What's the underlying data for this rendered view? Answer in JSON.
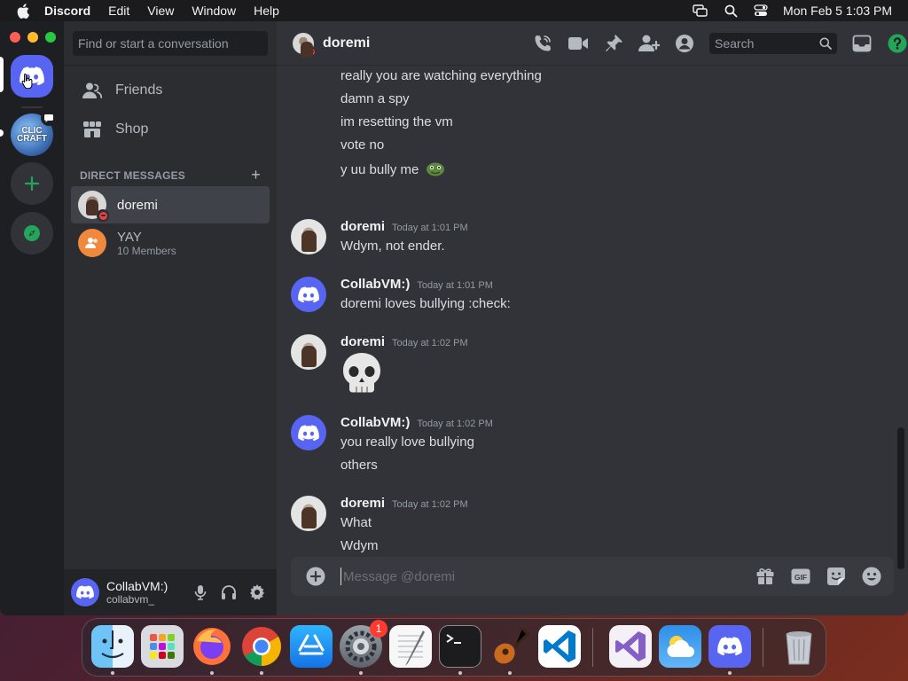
{
  "menubar": {
    "app_name": "Discord",
    "menus": [
      "Edit",
      "View",
      "Window",
      "Help"
    ],
    "clock": "Mon Feb 5  1:03 PM"
  },
  "sidebar": {
    "search_placeholder": "Find or start a conversation",
    "nav": [
      {
        "label": "Friends",
        "icon": "friends-icon"
      },
      {
        "label": "Shop",
        "icon": "shop-icon"
      }
    ],
    "dm_header": "DIRECT MESSAGES",
    "dms": [
      {
        "name": "doremi",
        "subtitle": "",
        "status": "dnd",
        "active": true
      },
      {
        "name": "YAY",
        "subtitle": "10 Members",
        "status": "",
        "active": false
      }
    ]
  },
  "server_rail": {
    "server_art_text": "CLIC CRAFT"
  },
  "user_panel": {
    "display_name": "CollabVM:)",
    "username": "collabvm_"
  },
  "chat": {
    "title": "doremi",
    "search_placeholder": "Search",
    "continued_lines": [
      "really you are watching everything",
      "damn a spy",
      "im resetting the vm",
      "vote no",
      "y uu bully me"
    ],
    "messages": [
      {
        "author": "doremi",
        "time": "Today at 1:01 PM",
        "lines": [
          "Wdym, not ender."
        ]
      },
      {
        "author": "CollabVM:)",
        "time": "Today at 1:01 PM",
        "lines": [
          "doremi loves bullying :check:"
        ]
      },
      {
        "author": "doremi",
        "time": "Today at 1:02 PM",
        "lines": []
      },
      {
        "author": "CollabVM:)",
        "time": "Today at 1:02 PM",
        "lines": [
          "you really love bullying",
          "others"
        ]
      },
      {
        "author": "doremi",
        "time": "Today at 1:02 PM",
        "lines": [
          "What",
          "Wdym"
        ]
      }
    ],
    "composer_placeholder": "Message @doremi"
  },
  "dock": {
    "apps": [
      "Finder",
      "Launchpad",
      "Firefox",
      "Chrome",
      "App Store",
      "System Settings",
      "TextEdit",
      "Terminal",
      "GarageBand",
      "Visual Studio Code",
      "Visual Studio",
      "Weather",
      "Discord",
      "Trash"
    ],
    "settings_badge": "1"
  },
  "colors": {
    "blurple": "#5865f2",
    "dnd_red": "#f23f43",
    "green": "#23a55a",
    "bg_chat": "#313338",
    "bg_sidebar": "#2b2d31",
    "bg_rail": "#1e1f22"
  }
}
